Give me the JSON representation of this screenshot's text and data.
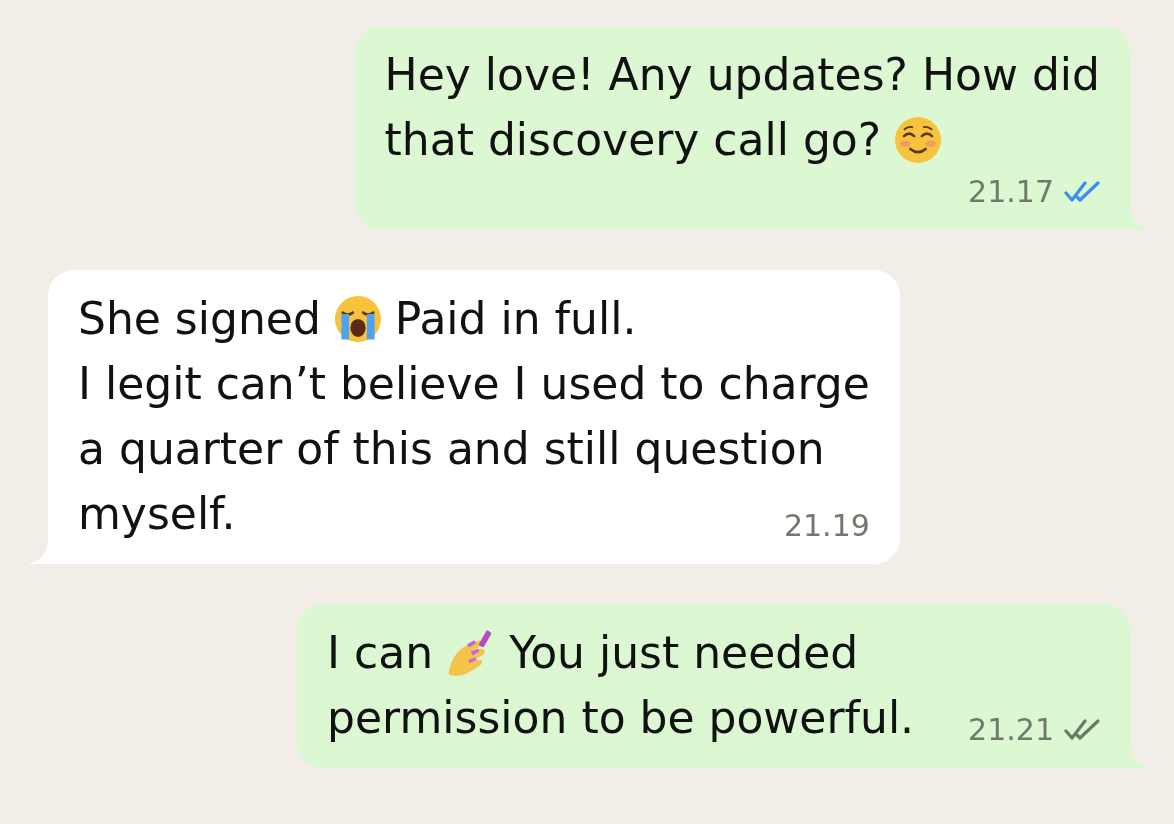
{
  "messages": [
    {
      "outgoing": true,
      "lines": [
        [
          {
            "kind": "text",
            "text": "Hey love! Any updates? How did"
          }
        ],
        [
          {
            "kind": "text",
            "text": "that discovery call go?"
          },
          {
            "kind": "smiling-face"
          }
        ]
      ],
      "time": "21.17",
      "read": true
    },
    {
      "outgoing": false,
      "lines": [
        [
          {
            "kind": "text",
            "text": "She signed"
          },
          {
            "kind": "crying-face"
          },
          {
            "kind": "text",
            "text": "Paid in full."
          }
        ],
        [
          {
            "kind": "text",
            "text": "I legit can’t believe I used to charge"
          }
        ],
        [
          {
            "kind": "text",
            "text": "a quarter of this and still question"
          }
        ],
        [
          {
            "kind": "text",
            "text": "myself."
          }
        ]
      ],
      "time": "21.19"
    },
    {
      "outgoing": true,
      "lines": [
        [
          {
            "kind": "text",
            "text": "I can"
          },
          {
            "kind": "nail-polish"
          },
          {
            "kind": "text",
            "text": "You just needed"
          }
        ],
        [
          {
            "kind": "text",
            "text": "permission to be powerful."
          }
        ]
      ],
      "time": "21.21",
      "read": false
    }
  ]
}
